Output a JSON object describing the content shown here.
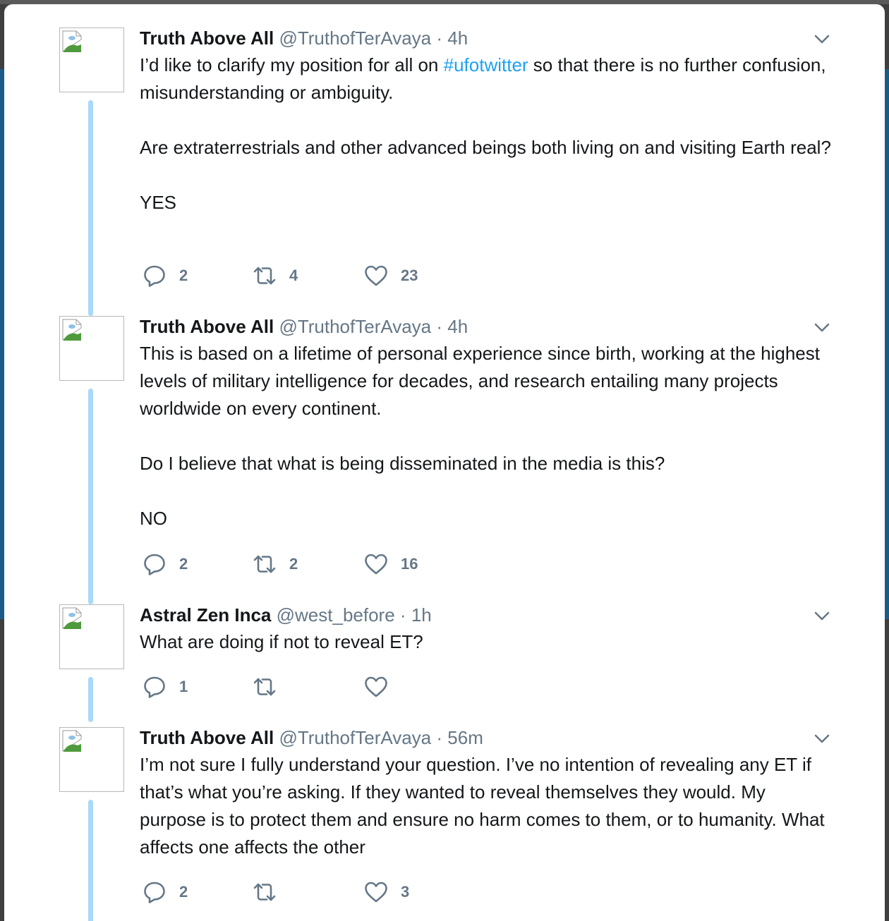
{
  "colors": {
    "accent": "#1da1f2",
    "thread_line": "#a9d8f8",
    "muted": "#657786"
  },
  "icons": {
    "reply": "reply-icon",
    "retweet": "retweet-icon",
    "like": "heart-icon",
    "caret": "chevron-down-icon",
    "avatar": "broken-image-icon"
  },
  "tweets": [
    {
      "name": "Truth Above All",
      "handle": "@TruthofTerAvaya",
      "sep": "·",
      "time": "4h",
      "body": {
        "p1_pre": "I’d like to clarify my position for all on ",
        "hashtag": "#ufotwitter",
        "p1_post": " so that there is no further confusion, misunderstanding or ambiguity.",
        "p2": "Are extraterrestrials and other advanced beings both living on and visiting Earth real?",
        "p3": "YES"
      },
      "replies": "2",
      "retweets": "4",
      "likes": "23"
    },
    {
      "name": "Truth Above All",
      "handle": "@TruthofTerAvaya",
      "sep": "·",
      "time": "4h",
      "body": {
        "p1": "This is based on a lifetime of personal experience since birth, working at the highest levels of military intelligence for decades, and research entailing many projects worldwide on every continent.",
        "p2": "Do I believe that what is being disseminated in the media is this?",
        "p3": "NO"
      },
      "replies": "2",
      "retweets": "2",
      "likes": "16"
    },
    {
      "name": "Astral Zen Inca",
      "handle": "@west_before",
      "sep": "·",
      "time": "1h",
      "body": {
        "p1": "What are doing if not to reveal ET?"
      },
      "replies": "1",
      "retweets": "",
      "likes": ""
    },
    {
      "name": "Truth Above All",
      "handle": "@TruthofTerAvaya",
      "sep": "·",
      "time": "56m",
      "body": {
        "p1": "I’m not sure I fully understand your question. I’ve no intention of revealing any ET if that’s what you’re asking. If they wanted to reveal themselves they would. My purpose is to protect them and ensure no harm comes to them, or to humanity. What affects one affects the other"
      },
      "replies": "2",
      "retweets": "",
      "likes": "3"
    }
  ]
}
